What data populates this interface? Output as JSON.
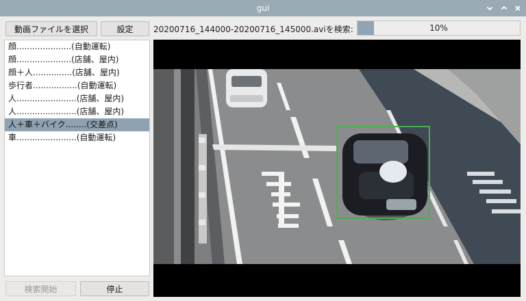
{
  "window": {
    "title": "gui"
  },
  "toolbar": {
    "select_video_label": "動画ファイルを選択",
    "settings_label": "設定",
    "search_file_label": "20200716_144000-20200716_145000.aviを検索:"
  },
  "progress": {
    "value": 0.1,
    "text": "10%"
  },
  "list": {
    "items": [
      "顔.....................(自動運転)",
      "顔.....................(店舗、屋内)",
      "顔＋人...............(店舗、屋内)",
      "歩行者.................(自動運転)",
      "人.......................(店舗、屋内)",
      "人.......................(店舗、屋内)",
      "人＋車＋バイク........(交差点)",
      "車.......................(自動運転)"
    ],
    "selected_index": 6
  },
  "buttons": {
    "start_search_label": "検索開始",
    "stop_label": "停止"
  },
  "colors": {
    "titlebar": "#9aabb6",
    "selection": "#8ea2b2",
    "progress_fill": "#8fa5b5",
    "detection_box": "#4caf50"
  },
  "icons": [
    "minimize-icon",
    "maximize-icon",
    "close-icon"
  ]
}
